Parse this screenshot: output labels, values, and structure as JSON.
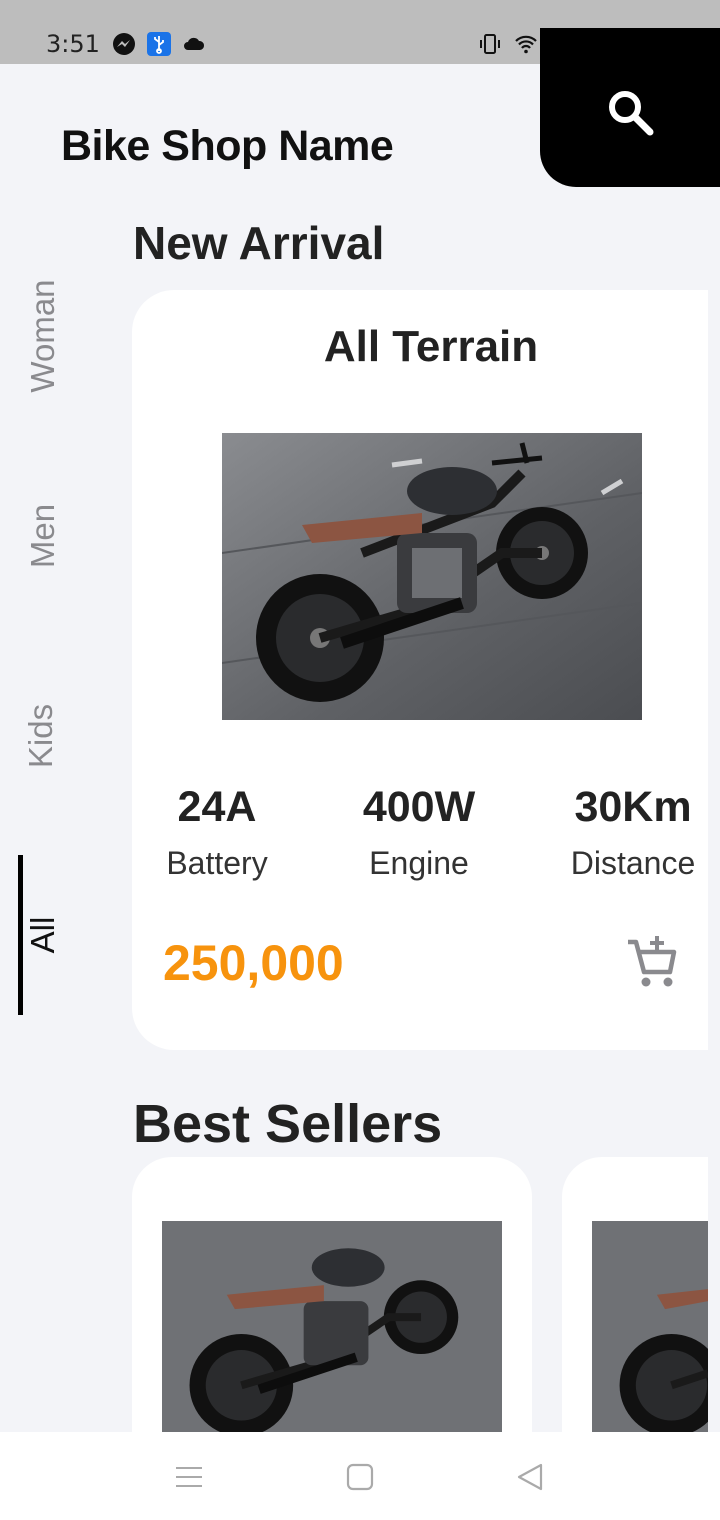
{
  "status_bar": {
    "time": "3:51",
    "icons": [
      "messenger-icon",
      "usb-icon",
      "cloud-icon",
      "vibrate-icon",
      "wifi-icon"
    ]
  },
  "header": {
    "shop_name": "Bike Shop Name",
    "search_icon": "search-icon"
  },
  "categories": [
    {
      "label": "Woman",
      "active": false
    },
    {
      "label": "Men",
      "active": false
    },
    {
      "label": "Kids",
      "active": false
    },
    {
      "label": "All",
      "active": true
    }
  ],
  "new_arrival": {
    "section_title": "New Arrival",
    "card": {
      "title": "All Terrain",
      "specs": [
        {
          "value": "24A",
          "label": "Battery"
        },
        {
          "value": "400W",
          "label": "Engine"
        },
        {
          "value": "30Km",
          "label": "Distance"
        }
      ],
      "price": "250,000",
      "cart_icon": "add-to-cart-icon"
    }
  },
  "best_sellers": {
    "section_title": "Best Sellers"
  },
  "nav_bar": {
    "icons": [
      "menu-icon",
      "home-icon",
      "back-icon"
    ]
  },
  "colors": {
    "accent_price": "#f7930d",
    "background": "#f3f4f8",
    "search_tab": "#000000"
  }
}
